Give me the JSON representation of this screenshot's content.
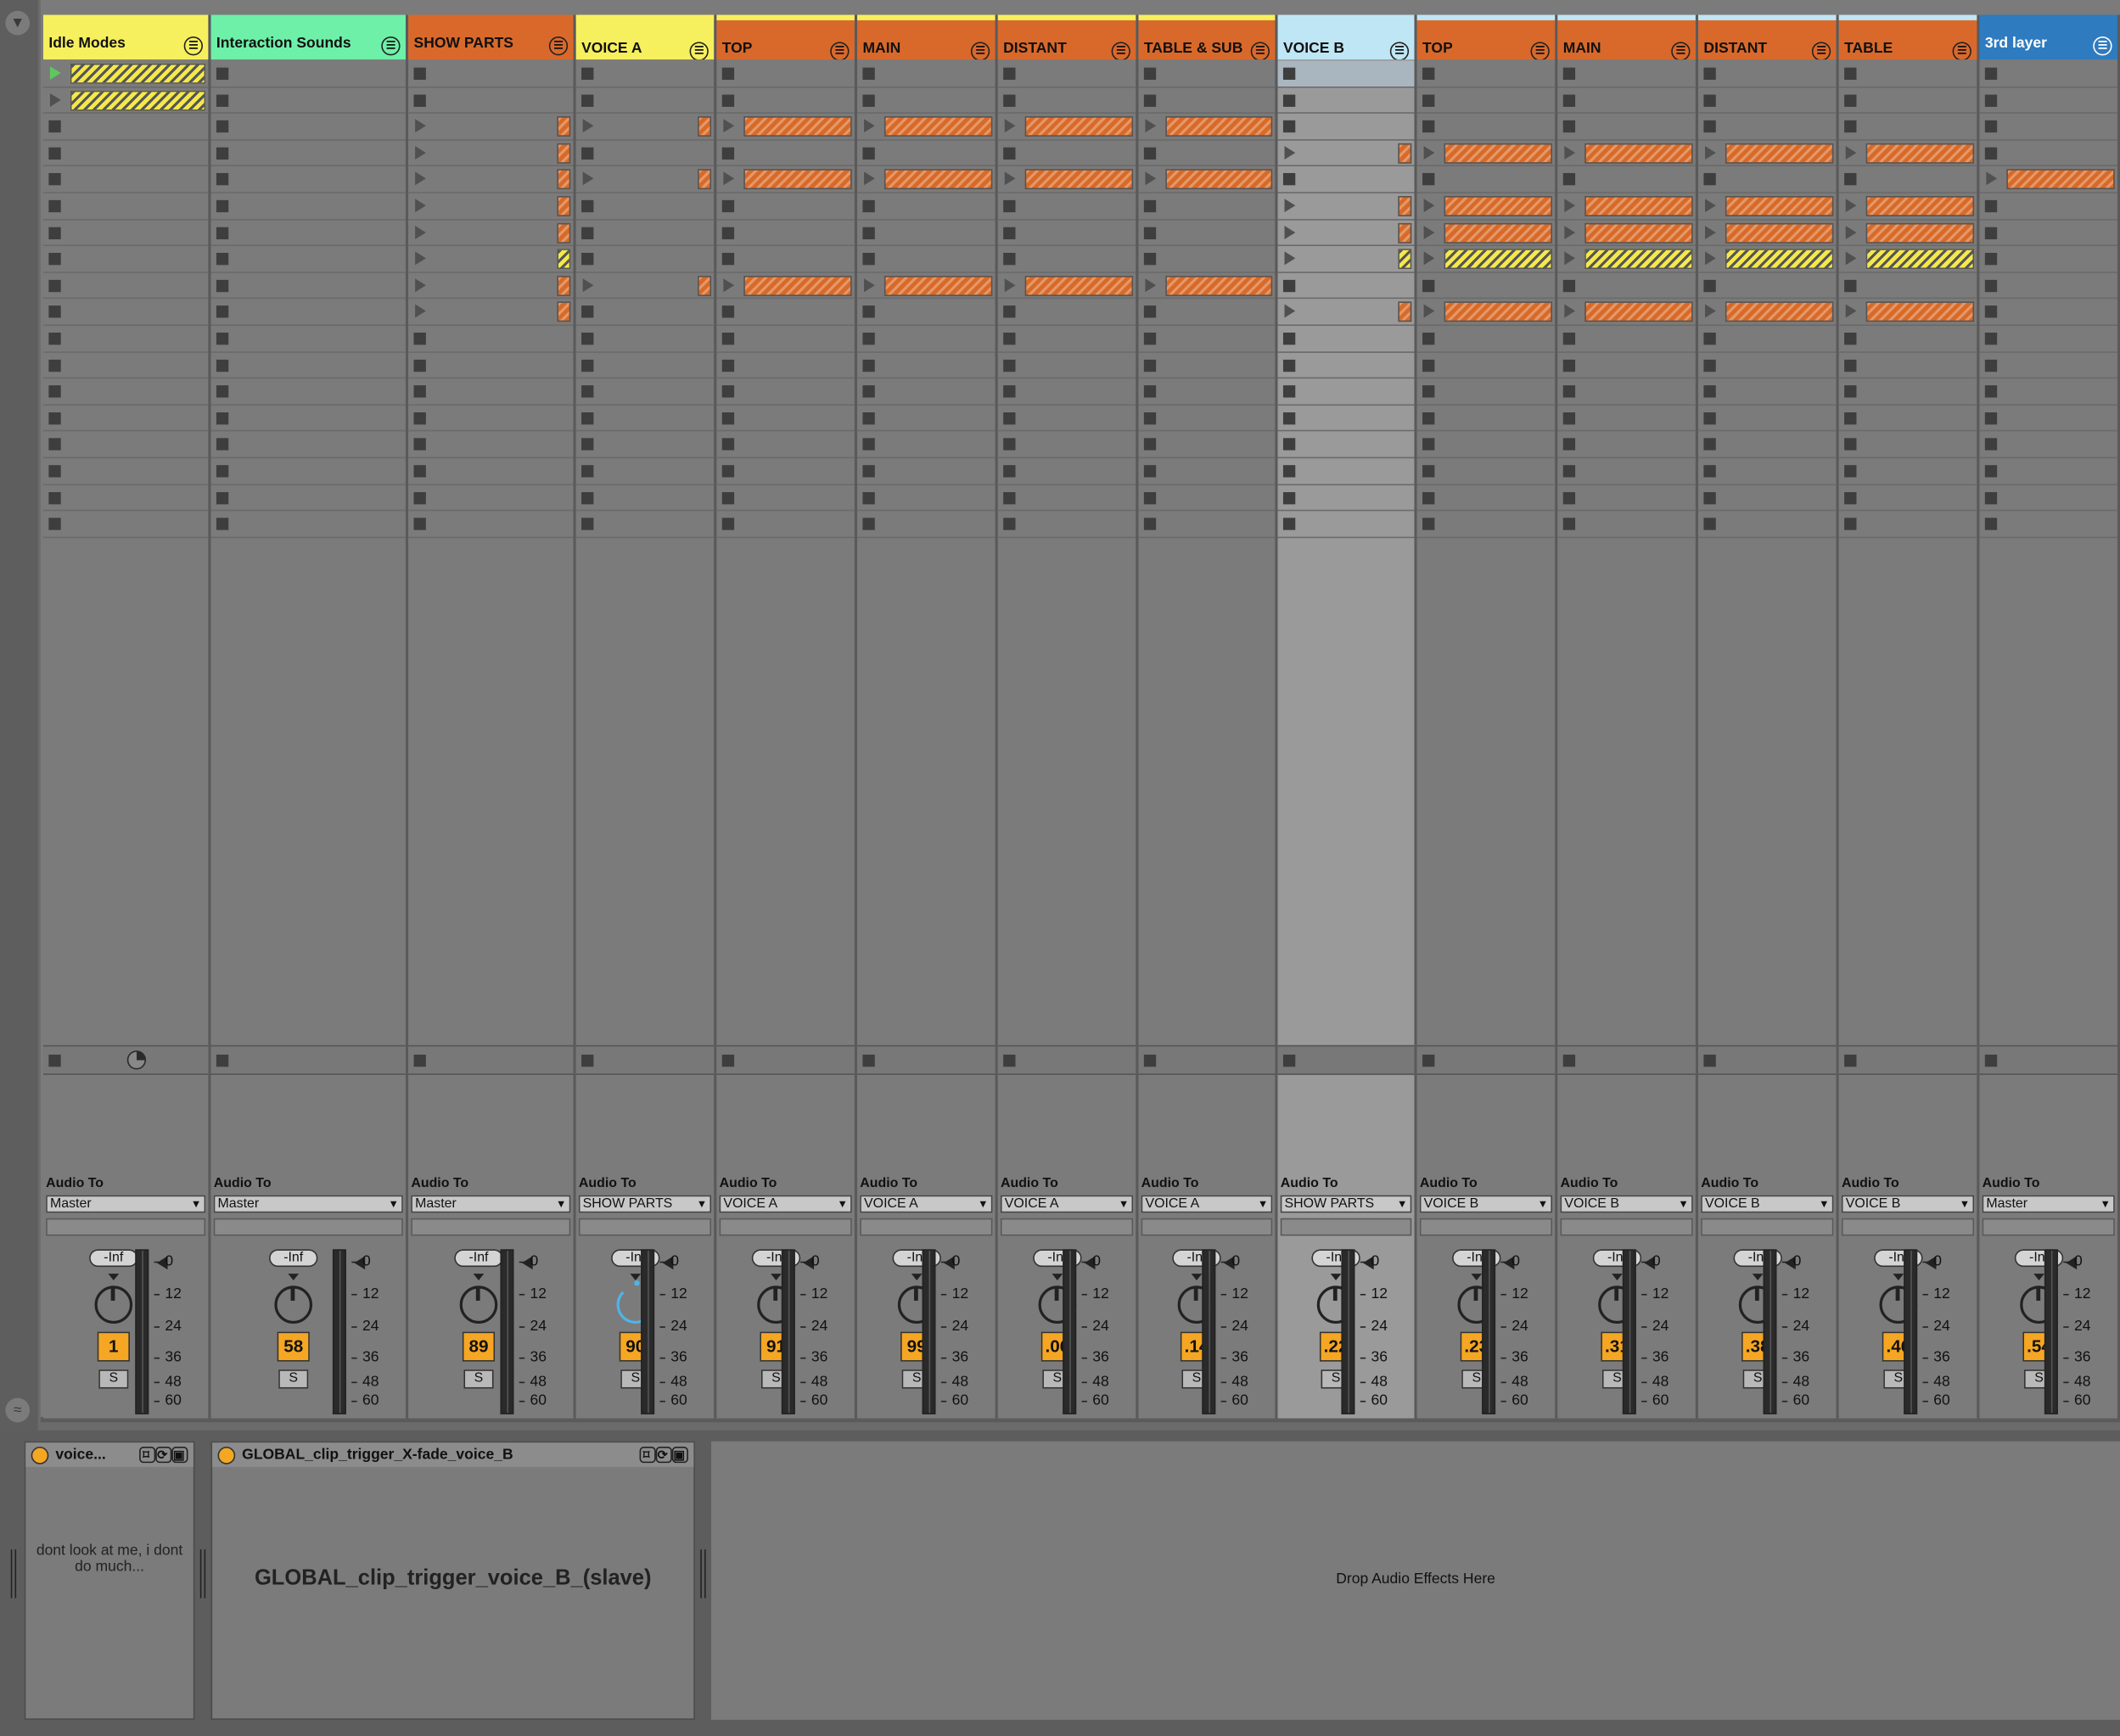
{
  "tracks": [
    {
      "name": "Idle Modes",
      "color": "#f7f05e",
      "light": false,
      "output": "Master",
      "number": "1",
      "fold": "☰"
    },
    {
      "name": "Interaction Sounds",
      "color": "#6ef0a8",
      "light": false,
      "output": "Master",
      "number": "58",
      "fold": "☰"
    },
    {
      "name": "SHOW PARTS",
      "color": "#d9692b",
      "light": false,
      "output": "Master",
      "number": "89",
      "fold": "☰"
    },
    {
      "name": "VOICE A",
      "color": "#f7f05e",
      "light": false,
      "output": "SHOW PARTS",
      "number": "90",
      "fold": "☰"
    },
    {
      "name": "TOP",
      "color": "#d9692b",
      "light": false,
      "output": "VOICE A",
      "number": "91",
      "fold": "☰"
    },
    {
      "name": "MAIN",
      "color": "#d9692b",
      "light": false,
      "output": "VOICE A",
      "number": "99",
      "fold": "☰"
    },
    {
      "name": "DISTANT",
      "color": "#d9692b",
      "light": false,
      "output": "VOICE A",
      "number": ".06",
      "fold": "☰"
    },
    {
      "name": "TABLE & SUB",
      "color": "#d9692b",
      "light": false,
      "output": "VOICE A",
      "number": ".14",
      "fold": "☰"
    },
    {
      "name": "VOICE B",
      "color": "#bfe6f5",
      "light": false,
      "output": "SHOW PARTS",
      "number": ".22",
      "fold": "☰"
    },
    {
      "name": "TOP",
      "color": "#d9692b",
      "light": false,
      "output": "VOICE B",
      "number": ".23",
      "fold": "☰"
    },
    {
      "name": "MAIN",
      "color": "#d9692b",
      "light": false,
      "output": "VOICE B",
      "number": ".31",
      "fold": "☰"
    },
    {
      "name": "DISTANT",
      "color": "#d9692b",
      "light": false,
      "output": "VOICE B",
      "number": ".38",
      "fold": "☰"
    },
    {
      "name": "TABLE",
      "color": "#d9692b",
      "light": false,
      "output": "VOICE B",
      "number": ".46",
      "fold": "☰"
    },
    {
      "name": "3rd layer",
      "color": "#2f7bbf",
      "light": true,
      "output": "Master",
      "number": ".54",
      "fold": "☰"
    }
  ],
  "routing_label": "Audio To",
  "volume_value": "-Inf",
  "solo_label": "S",
  "meter_scale": [
    "0",
    "12",
    "24",
    "36",
    "48",
    "60"
  ],
  "devices": {
    "device1_title": "voice...",
    "device1_text": "dont look at me, i dont do much...",
    "device2_title": "GLOBAL_clip_trigger_X-fade_voice_B",
    "device2_text": "GLOBAL_clip_trigger_voice_B_(slave)",
    "drop_text": "Drop Audio Effects Here"
  },
  "colors": {
    "orange": "#d9692b",
    "yellow": "#f7f05e",
    "selected_track": "#9a9a9a",
    "background": "#7b7b7b"
  }
}
